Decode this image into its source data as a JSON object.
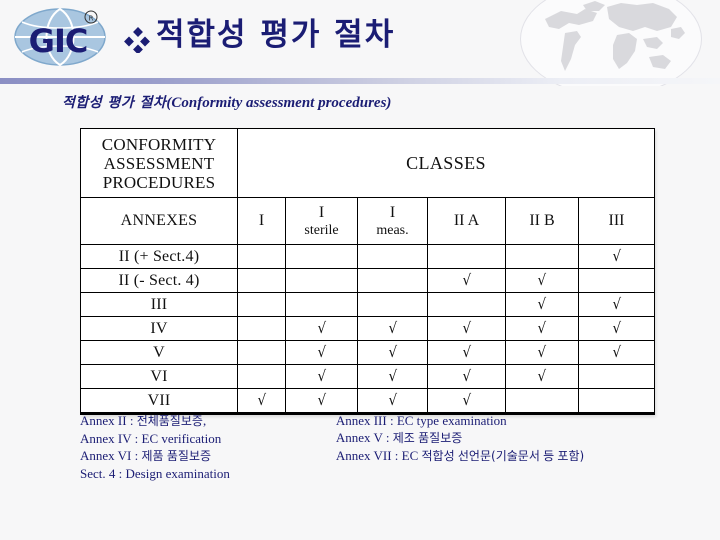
{
  "header": {
    "logo_text": "GIC",
    "logo_registered_mark": "®",
    "bullet_icon": "diamond-bullet-icon",
    "title": "적합성 평가 절차",
    "watermark_icon": "world-map-globe-icon",
    "accent_color": "#1b1d74",
    "rule_color": "#8b8fc4"
  },
  "subtitle": {
    "korean": "적합성 평가 절차",
    "english": "(Conformity assessment procedures)"
  },
  "table": {
    "corner_header": "CONFORMITY ASSESSMENT PROCEDURES",
    "classes_header": "CLASSES",
    "annexes_header": "ANNEXES",
    "class_columns": [
      {
        "main": "I",
        "sub": ""
      },
      {
        "main": "I",
        "sub": "sterile"
      },
      {
        "main": "I",
        "sub": "meas."
      },
      {
        "main": "II A",
        "sub": ""
      },
      {
        "main": "II B",
        "sub": ""
      },
      {
        "main": "III",
        "sub": ""
      }
    ],
    "tick_symbol": "√",
    "rows": [
      {
        "label": "II (+ Sect.4)",
        "marks": [
          false,
          false,
          false,
          false,
          false,
          true
        ]
      },
      {
        "label": "II (- Sect. 4)",
        "marks": [
          false,
          false,
          false,
          true,
          true,
          false
        ]
      },
      {
        "label": "III",
        "marks": [
          false,
          false,
          false,
          false,
          true,
          true
        ]
      },
      {
        "label": "IV",
        "marks": [
          false,
          true,
          true,
          true,
          true,
          true
        ]
      },
      {
        "label": "V",
        "marks": [
          false,
          true,
          true,
          true,
          true,
          true
        ]
      },
      {
        "label": "VI",
        "marks": [
          false,
          true,
          true,
          true,
          true,
          false
        ]
      },
      {
        "label": "VII",
        "marks": [
          true,
          true,
          true,
          true,
          false,
          false
        ]
      }
    ]
  },
  "footnotes": {
    "left": [
      "Annex II : 전체품질보증,",
      "Annex IV : EC verification",
      "Annex VI : 제품 품질보증",
      "Sect. 4 : Design examination"
    ],
    "right": [
      "Annex III : EC type examination",
      "Annex V : 제조 품질보증",
      "Annex VII : EC 적합성 선언문(기술문서 등 포함)"
    ]
  }
}
